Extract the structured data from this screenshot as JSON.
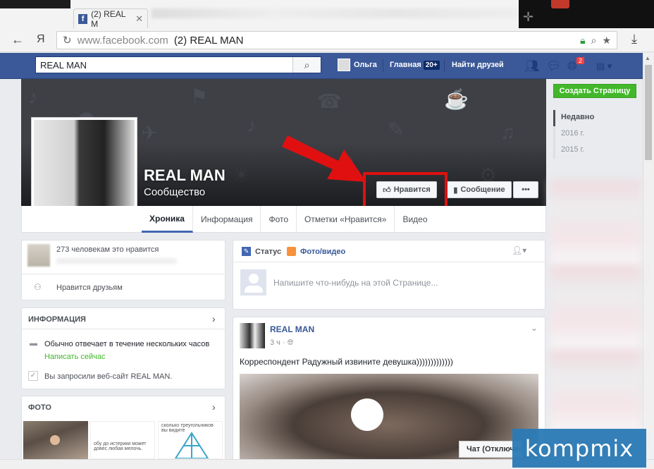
{
  "browser": {
    "tab_title": "(2) REAL M",
    "url_domain": "www.facebook.com",
    "url_title": "(2) REAL MAN"
  },
  "fbbar": {
    "search_value": "REAL MAN",
    "user_name": "Ольга",
    "home_label": "Главная",
    "home_badge": "20+",
    "find_friends": "Найти друзей",
    "notif_count": "2"
  },
  "page": {
    "name": "REAL MAN",
    "category": "Сообщество",
    "like_button": "Нравится",
    "message_button": "Сообщение",
    "more_button": "•••",
    "tabs": [
      "Хроника",
      "Информация",
      "Фото",
      "Отметки «Нравится»",
      "Видео"
    ]
  },
  "right": {
    "create_page": "Создать Страницу",
    "years": [
      "Недавно",
      "2016 г.",
      "2015 г."
    ]
  },
  "left": {
    "likes_text": "273 человекам это нравится",
    "friends_like": "Нравится друзьям",
    "info_header": "ИНФОРМАЦИЯ",
    "response_text": "Обычно отвечает в течение нескольких часов",
    "send_message": "Написать сейчас",
    "website_text": "Вы запросили веб-сайт REAL MAN.",
    "photo_header": "ФОТО",
    "photo2_text": "обу до истерики может довес любая мелочь.",
    "photo3_text": "сколько треугольников вы видите"
  },
  "composer": {
    "status": "Статус",
    "photo_video": "Фото/видео",
    "placeholder": "Напишите что-нибудь на этой Странице..."
  },
  "post": {
    "author": "REAL MAN",
    "time": "3 ч",
    "text": "Корреспондент Радужный извините девушка)))))))))))))"
  },
  "chat": "Чат (Отключен",
  "watermark": "kompmix"
}
